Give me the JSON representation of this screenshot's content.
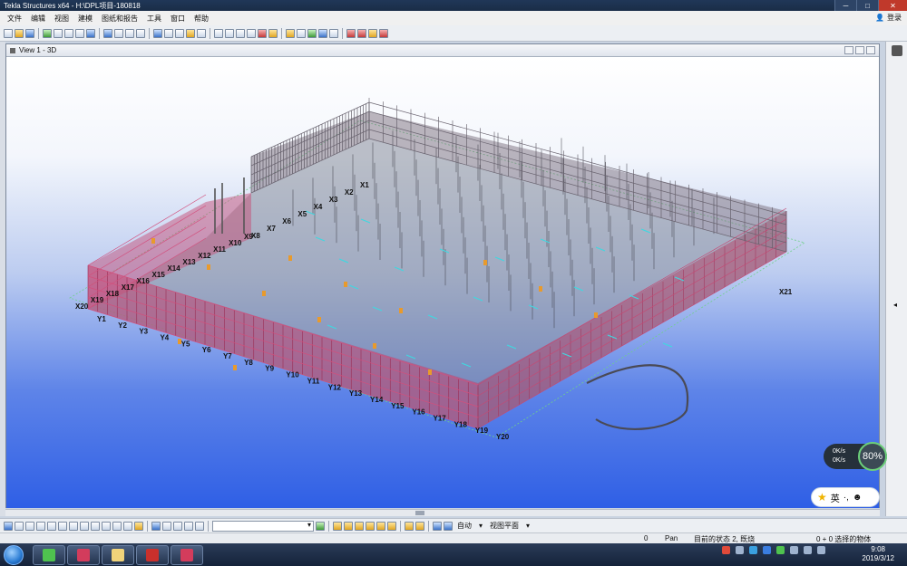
{
  "window": {
    "title": "Tekla Structures x64 - H:\\DPL项目-180818"
  },
  "menu": {
    "items": [
      "文件",
      "编辑",
      "视图",
      "建模",
      "图纸和报告",
      "工具",
      "窗口",
      "帮助"
    ],
    "login": "登录"
  },
  "view": {
    "title": "View 1 - 3D"
  },
  "grid_labels_x": [
    "X20",
    "X19",
    "X18",
    "X17",
    "X16",
    "X15",
    "X14",
    "X13",
    "X12",
    "X11",
    "X10",
    "X9",
    "X8",
    "X7",
    "X6",
    "X5",
    "X4",
    "X3",
    "X2",
    "X1",
    "X21"
  ],
  "grid_labels_y": [
    "Y1",
    "Y2",
    "Y3",
    "Y4",
    "Y5",
    "Y6",
    "Y7",
    "Y8",
    "Y9",
    "Y10",
    "Y11",
    "Y12",
    "Y13",
    "Y14",
    "Y15",
    "Y16",
    "Y17",
    "Y18",
    "Y19",
    "Y20"
  ],
  "bottom_toolbar": {
    "select_value": "",
    "snap_label": "自动",
    "plane_label": "视图平面"
  },
  "status": {
    "count": "0",
    "mode": "Pan",
    "state": "目前的状态 2, 既烧",
    "selection": "0 + 0 选择的物体"
  },
  "net_widget": {
    "up": "0K/s",
    "down": "0K/s",
    "percent": "80%"
  },
  "ime": {
    "lang": "英"
  },
  "clock": {
    "time": "9:08",
    "date": "2019/3/12"
  }
}
